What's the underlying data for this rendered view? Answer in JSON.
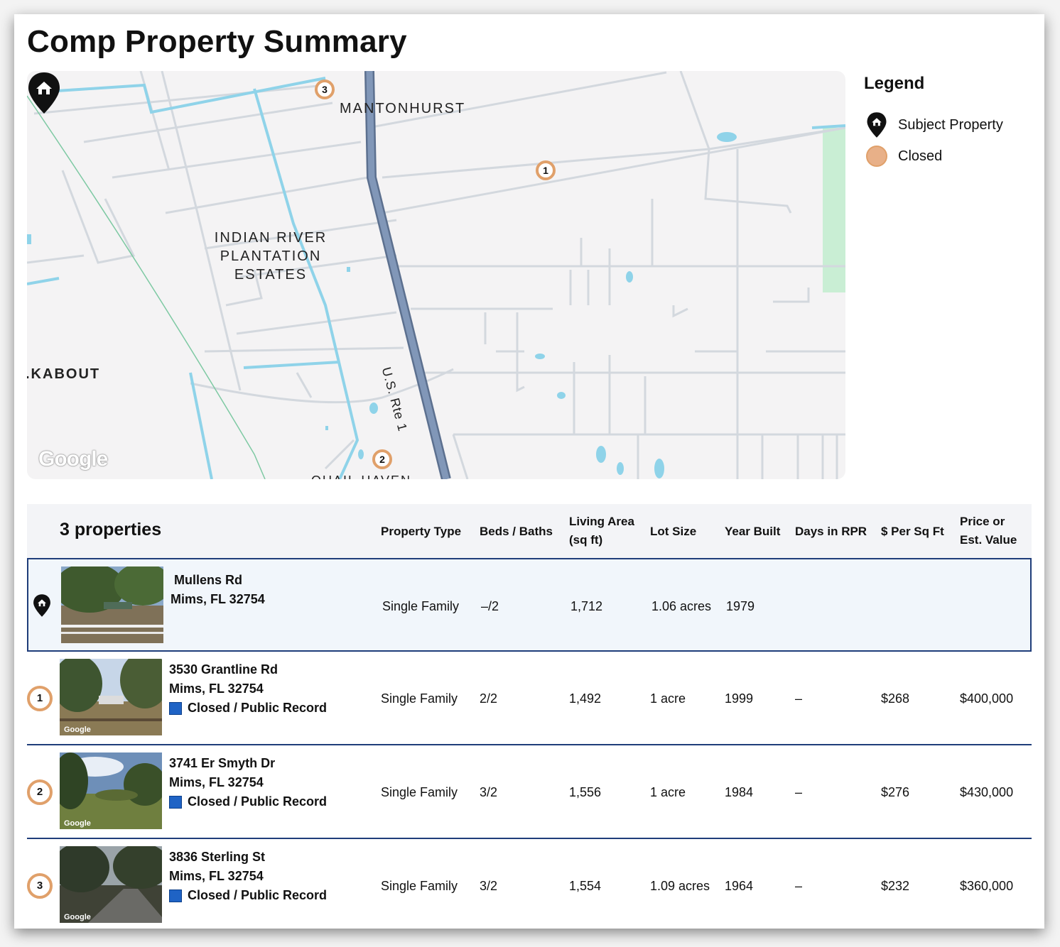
{
  "page": {
    "title": "Comp Property Summary"
  },
  "map": {
    "labels": {
      "mantonhurst": "MANTONHURST",
      "indian_river": "INDIAN RIVER\nPLANTATION\nESTATES",
      "lookabout": ".KABOUT",
      "route": "U.S. Rte 1",
      "quail_haven": "QUAIL HAVEN"
    },
    "markers": [
      {
        "number": "3"
      },
      {
        "number": "1"
      },
      {
        "number": "2"
      }
    ],
    "attribution": "Google",
    "colors": {
      "background": "#f4f3f4",
      "road": "#d0d5dc",
      "highway": "#8197b8",
      "water": "#8fd3e9",
      "park": "#c9eed4",
      "marker_ring": "#e0a06a"
    }
  },
  "legend": {
    "title": "Legend",
    "items": [
      {
        "label": "Subject Property",
        "icon": "house-pin-icon"
      },
      {
        "label": "Closed",
        "icon": "closed-dot-icon",
        "color": "#e8b088"
      }
    ]
  },
  "table": {
    "count_label": "3 properties",
    "columns": {
      "property_type": "Property Type",
      "beds_baths": "Beds / Baths",
      "living_area_1": "Living Area",
      "living_area_2": "(sq ft)",
      "lot_size": "Lot Size",
      "year_built": "Year Built",
      "days_in_rpr": "Days in RPR",
      "per_sq_ft": "$ Per Sq Ft",
      "price_1": "Price or",
      "price_2": "Est. Value"
    },
    "subject": {
      "street": "Mullens Rd",
      "city": "Mims, FL 32754",
      "property_type": "Single Family",
      "beds_baths": "–/2",
      "living_area": "1,712",
      "lot_size": "1.06 acres",
      "year_built": "1979"
    },
    "comps": [
      {
        "number": "1",
        "street": "3530 Grantline Rd",
        "city": "Mims, FL 32754",
        "status": "Closed / Public Record",
        "property_type": "Single Family",
        "beds_baths": "2/2",
        "living_area": "1,492",
        "lot_size": "1 acre",
        "year_built": "1999",
        "days_in_rpr": "–",
        "per_sq_ft": "$268",
        "price": "$400,000",
        "photo_tag": "Google"
      },
      {
        "number": "2",
        "street": "3741 Er Smyth Dr",
        "city": "Mims, FL 32754",
        "status": "Closed / Public Record",
        "property_type": "Single Family",
        "beds_baths": "3/2",
        "living_area": "1,556",
        "lot_size": "1 acre",
        "year_built": "1984",
        "days_in_rpr": "–",
        "per_sq_ft": "$276",
        "price": "$430,000",
        "photo_tag": "Google"
      },
      {
        "number": "3",
        "street": "3836 Sterling St",
        "city": "Mims, FL 32754",
        "status": "Closed / Public Record",
        "property_type": "Single Family",
        "beds_baths": "3/2",
        "living_area": "1,554",
        "lot_size": "1.09 acres",
        "year_built": "1964",
        "days_in_rpr": "–",
        "per_sq_ft": "$232",
        "price": "$360,000",
        "photo_tag": "Google"
      }
    ],
    "status_color": "#1f63c5",
    "divider_color": "#1f3d7a"
  }
}
